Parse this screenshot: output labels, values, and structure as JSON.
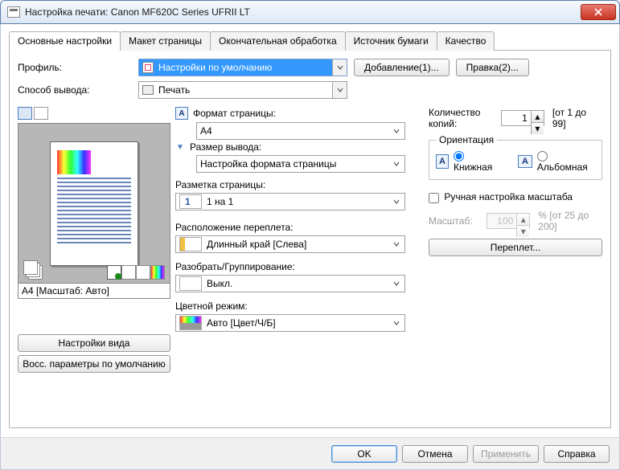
{
  "window": {
    "title": "Настройка печати: Canon MF620C Series UFRII LT"
  },
  "tabs": [
    "Основные настройки",
    "Макет страницы",
    "Окончательная обработка",
    "Источник бумаги",
    "Качество"
  ],
  "profile": {
    "label": "Профиль:",
    "value": "Настройки по умолчанию",
    "add_btn": "Добавление(1)...",
    "edit_btn": "Правка(2)..."
  },
  "output": {
    "label": "Способ вывода:",
    "value": "Печать"
  },
  "preview": {
    "caption": "A4 [Масштаб: Авто]",
    "view_btn": "Настройки вида",
    "reset_btn": "Восс. параметры по умолчанию"
  },
  "settings": {
    "page_size": {
      "label": "Формат страницы:",
      "value": "A4"
    },
    "out_size": {
      "label": "Размер вывода:",
      "value": "Настройка формата страницы"
    },
    "layout": {
      "label": "Разметка страницы:",
      "value": "1 на 1"
    },
    "binding": {
      "label": "Расположение переплета:",
      "value": "Длинный край [Слева]"
    },
    "collate": {
      "label": "Разобрать/Группирование:",
      "value": "Выкл."
    },
    "color": {
      "label": "Цветной режим:",
      "value": "Авто [Цвет/Ч/Б]"
    }
  },
  "right": {
    "copies": {
      "label": "Количество копий:",
      "value": "1",
      "range": "[от 1 до 99]"
    },
    "orient": {
      "legend": "Ориентация",
      "portrait": "Книжная",
      "landscape": "Альбомная"
    },
    "manual_scale": "Ручная настройка масштаба",
    "scale": {
      "label": "Масштаб:",
      "value": "100",
      "range": "% [от 25 до 200]"
    },
    "binding_btn": "Переплет..."
  },
  "footer": {
    "ok": "OK",
    "cancel": "Отмена",
    "apply": "Применить",
    "help": "Справка"
  }
}
